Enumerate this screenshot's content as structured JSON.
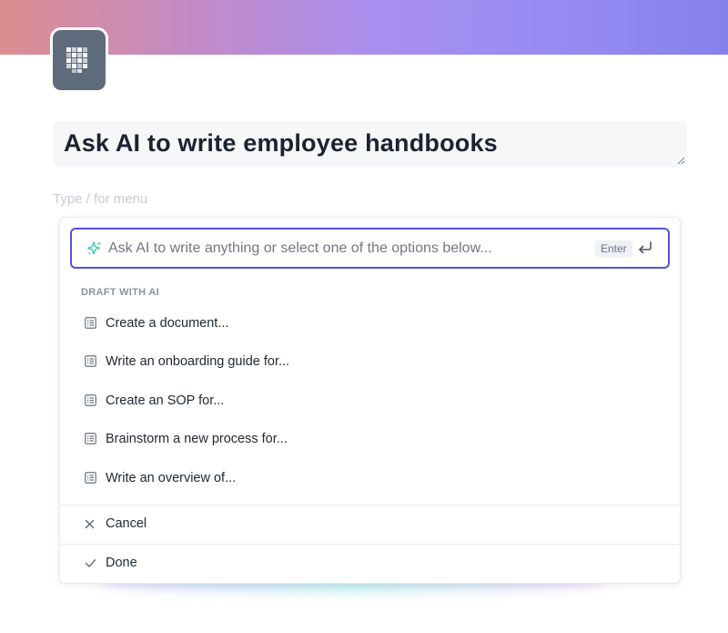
{
  "header": {
    "workspace_logo_icon": "grid-logo-icon",
    "banner_colors": [
      "#dc8d8f",
      "#a98ff0",
      "#8680ed"
    ]
  },
  "editor": {
    "title": "Ask AI to write employee handbooks",
    "menu_hint": "Type / for menu"
  },
  "ai_panel": {
    "input_placeholder": "Ask AI to write anything or select one of the options below...",
    "input_value": "",
    "enter_badge": "Enter",
    "accent_color": "#4f55d8",
    "section_title": "DRAFT WITH AI",
    "options": [
      {
        "label": "Create a document...",
        "icon": "document-list-icon"
      },
      {
        "label": "Write an onboarding guide for...",
        "icon": "document-list-icon"
      },
      {
        "label": "Create an SOP for...",
        "icon": "document-list-icon"
      },
      {
        "label": "Brainstorm a new process for...",
        "icon": "document-list-icon"
      },
      {
        "label": "Write an overview of...",
        "icon": "document-list-icon"
      }
    ],
    "actions": [
      {
        "label": "Cancel",
        "icon": "close-icon"
      },
      {
        "label": "Done",
        "icon": "check-icon"
      }
    ]
  }
}
